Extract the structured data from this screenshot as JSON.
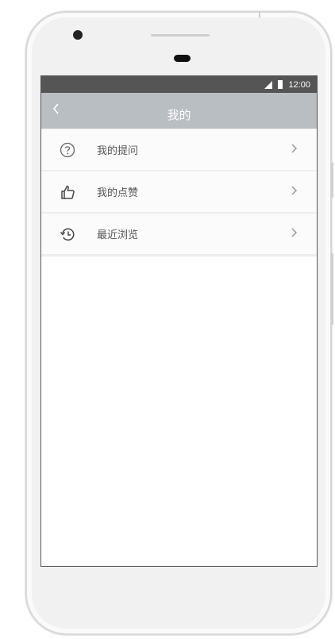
{
  "status_bar": {
    "time": "12:00",
    "signal_icon": "signal-icon",
    "battery_icon": "battery-icon"
  },
  "title_bar": {
    "title": "我的",
    "back_icon": "back-chevron-icon"
  },
  "menu": {
    "items": [
      {
        "label": "我的提问",
        "icon": "question-circle-icon"
      },
      {
        "label": "我的点赞",
        "icon": "thumbs-up-icon"
      },
      {
        "label": "最近浏览",
        "icon": "history-icon"
      }
    ]
  },
  "colors": {
    "title_bar": "#b9bec3",
    "status_bar": "#555555",
    "text": "#555555"
  }
}
